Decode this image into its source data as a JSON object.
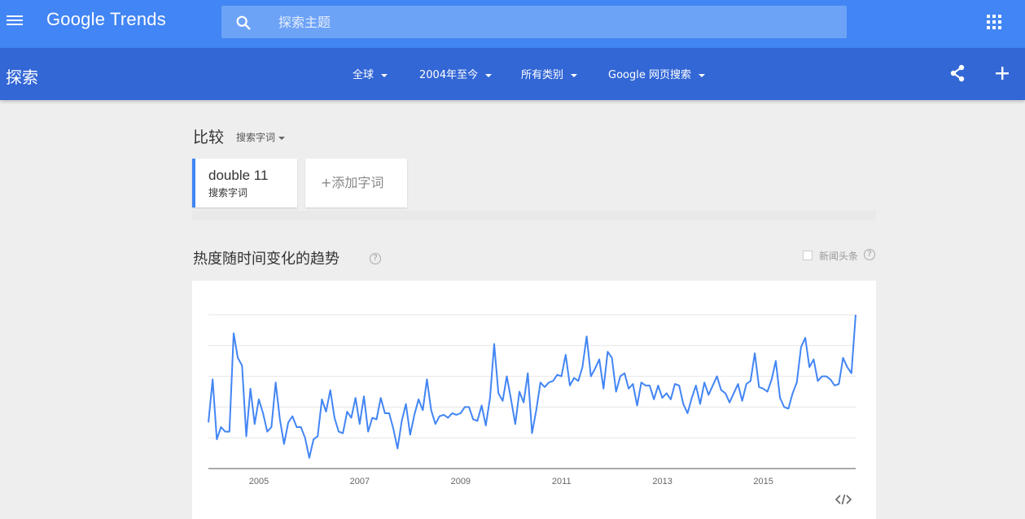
{
  "header": {
    "logo": "Google Trends",
    "search_placeholder": "探索主题"
  },
  "subbar": {
    "title": "探索",
    "filters": [
      {
        "label": "全球"
      },
      {
        "label": "2004年至今"
      },
      {
        "label": "所有类别"
      },
      {
        "label": "Google 网页搜索"
      }
    ]
  },
  "compare": {
    "label": "比较",
    "type_label": "搜索字词",
    "term": {
      "name": "double 11",
      "type": "搜索字词"
    },
    "add_label": "+添加字词"
  },
  "section": {
    "title": "热度随时间变化的趋势",
    "help": "?",
    "news_label": "新闻头条",
    "news_checked": false
  },
  "colors": {
    "topbar": "#4285f4",
    "subbar": "#3367d6",
    "line": "#4285f4"
  },
  "icons": [
    "menu-icon",
    "search-icon",
    "apps-icon",
    "share-icon",
    "plus-icon",
    "help-icon",
    "embed-icon"
  ],
  "chart_data": {
    "type": "line",
    "title": "",
    "xlabel": "",
    "ylabel": "",
    "x_start": 2004.0,
    "x_end": 2016.83,
    "ylim": [
      0,
      100
    ],
    "grid": true,
    "x_ticks": [
      "2005",
      "2007",
      "2009",
      "2011",
      "2013",
      "2015"
    ],
    "series": [
      {
        "values": [
          30,
          58,
          19,
          27,
          24,
          24,
          88,
          72,
          67,
          21,
          52,
          29,
          45,
          36,
          24,
          27,
          56,
          32,
          16,
          30,
          34,
          27,
          27,
          20,
          7,
          19,
          21,
          45,
          37,
          51,
          33,
          24,
          23,
          37,
          33,
          46,
          29,
          47,
          24,
          33,
          32,
          46,
          36,
          36,
          26,
          13,
          31,
          42,
          22,
          35,
          45,
          38,
          58,
          38,
          29,
          34,
          35,
          33,
          36,
          35,
          36,
          40,
          40,
          32,
          31,
          41,
          28,
          46,
          81,
          49,
          44,
          60,
          45,
          29,
          50,
          43,
          62,
          23,
          38,
          56,
          53,
          56,
          57,
          61,
          60,
          74,
          54,
          59,
          57,
          66,
          86,
          60,
          65,
          71,
          52,
          76,
          72,
          50,
          60,
          62,
          52,
          55,
          41,
          56,
          54,
          54,
          45,
          54,
          46,
          49,
          45,
          55,
          54,
          42,
          36,
          46,
          54,
          42,
          56,
          48,
          54,
          60,
          51,
          49,
          43,
          49,
          55,
          44,
          55,
          57,
          75,
          53,
          52,
          50,
          58,
          70,
          46,
          40,
          39,
          49,
          56,
          79,
          85,
          66,
          71,
          57,
          60,
          60,
          58,
          54,
          55,
          72,
          66,
          62,
          100
        ]
      }
    ]
  }
}
